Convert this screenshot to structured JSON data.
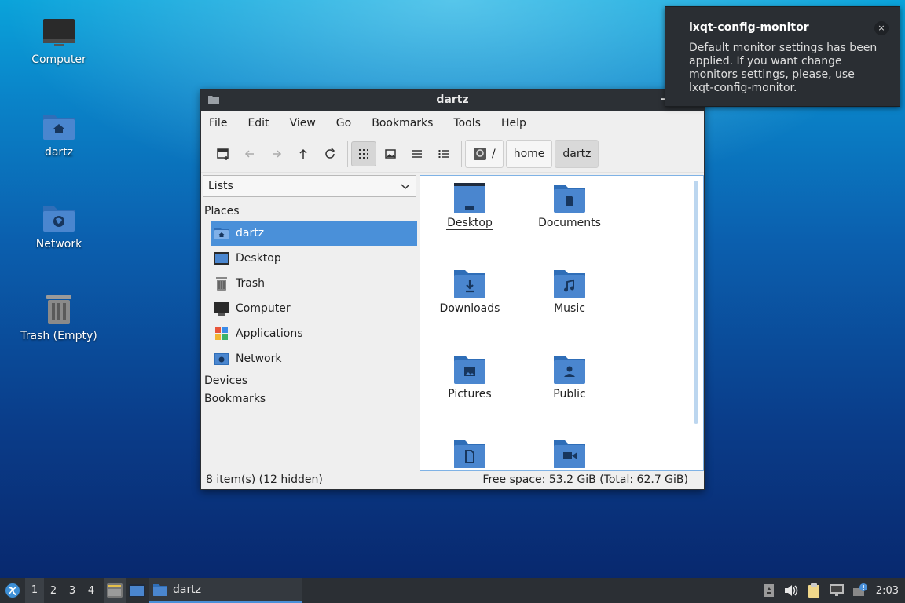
{
  "desktop": {
    "icons": [
      {
        "label": "Computer",
        "icon": "computer-icon"
      },
      {
        "label": "dartz",
        "icon": "home-folder-icon"
      },
      {
        "label": "Network",
        "icon": "network-folder-icon"
      },
      {
        "label": "Trash (Empty)",
        "icon": "trash-icon"
      }
    ]
  },
  "notification": {
    "title": "lxqt-config-monitor",
    "body": "Default monitor settings has been applied. If you want change monitors settings, please, use lxqt-config-monitor.",
    "close_label": "×"
  },
  "window": {
    "title": "dartz",
    "minimize_label": "–",
    "menu": [
      "File",
      "Edit",
      "View",
      "Go",
      "Bookmarks",
      "Tools",
      "Help"
    ],
    "breadcrumbs": [
      "/",
      "home",
      "dartz"
    ],
    "side_combo": "Lists",
    "sections": {
      "places": "Places",
      "devices": "Devices",
      "bookmarks": "Bookmarks"
    },
    "places": [
      {
        "label": "dartz",
        "icon": "home-folder-icon",
        "selected": true
      },
      {
        "label": "Desktop",
        "icon": "desktop-icon"
      },
      {
        "label": "Trash",
        "icon": "trash-icon"
      },
      {
        "label": "Computer",
        "icon": "computer-icon"
      },
      {
        "label": "Applications",
        "icon": "applications-icon"
      },
      {
        "label": "Network",
        "icon": "network-icon"
      }
    ],
    "files": [
      {
        "label": "Desktop",
        "icon": "desktop-folder-icon"
      },
      {
        "label": "Documents",
        "icon": "documents-folder-icon"
      },
      {
        "label": "Downloads",
        "icon": "downloads-folder-icon"
      },
      {
        "label": "Music",
        "icon": "music-folder-icon"
      },
      {
        "label": "Pictures",
        "icon": "pictures-folder-icon"
      },
      {
        "label": "Public",
        "icon": "public-folder-icon"
      },
      {
        "label": "",
        "icon": "templates-folder-icon"
      },
      {
        "label": "",
        "icon": "videos-folder-icon"
      }
    ],
    "status_left": "8 item(s) (12 hidden)",
    "status_right": "Free space: 53.2 GiB (Total: 62.7 GiB)"
  },
  "taskbar": {
    "workspaces": [
      "1",
      "2",
      "3",
      "4"
    ],
    "active_workspace": "1",
    "task_label": "dartz",
    "clock": "2:03"
  },
  "colors": {
    "accent": "#4a90d9",
    "folder": "#4a86cf",
    "folder_tab": "#2f6eb8",
    "panel": "#2b2f34"
  }
}
